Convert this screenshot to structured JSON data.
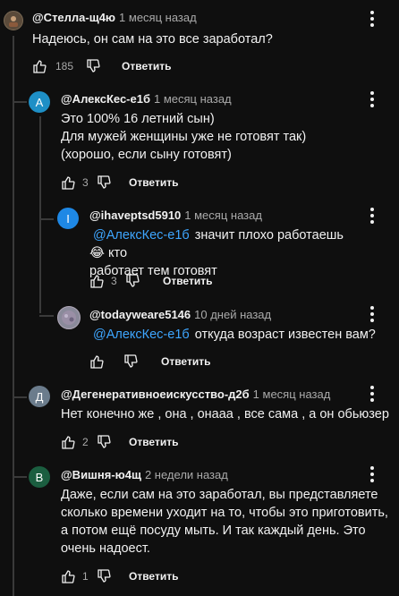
{
  "comments": [
    {
      "author": "@Стелла-щ4ю",
      "time": "1 месяц назад",
      "lines": [
        "Надеюсь, он сам на это все заработал?"
      ],
      "likes": "185",
      "reply_label": "Ответить",
      "avatar_letter": "",
      "avatar_color": "#5a4a3a"
    },
    {
      "author": "@АлексКес-е1б",
      "time": "1 месяц назад",
      "lines": [
        "Это 100% 16 летний сын)",
        "Для мужей женщины уже не готовят так)",
        "(хорошо, если сыну готовят)"
      ],
      "likes": "3",
      "reply_label": "Ответить",
      "avatar_letter": "A",
      "avatar_color": "#1e8fc6"
    },
    {
      "author": "@ihaveptsd5910",
      "time": "1 месяц назад",
      "mention": "@АлексКес-е1б",
      "lines": [
        "значит плохо работаешь 😂 кто",
        "работает тем готовят"
      ],
      "likes": "3",
      "reply_label": "Ответить",
      "avatar_letter": "I",
      "avatar_color": "#1e88e5"
    },
    {
      "author": "@todayweare5146",
      "time": "10 дней назад",
      "mention": "@АлексКес-е1б",
      "lines": [
        "откуда возраст известен вам?"
      ],
      "likes": "",
      "reply_label": "Ответить",
      "avatar_letter": "",
      "avatar_color": "#8a8a9a"
    },
    {
      "author": "@Дегенеративноеискусство-д2б",
      "time": "1 месяц назад",
      "lines": [
        "Нет конечно же , она , онааа , все сама , а он обьюзер"
      ],
      "likes": "2",
      "reply_label": "Ответить",
      "avatar_letter": "Д",
      "avatar_color": "#6b7c8c"
    },
    {
      "author": "@Вишня-ю4щ",
      "time": "2 недели назад",
      "lines": [
        "Даже, если сам на это заработал, вы представляете",
        "сколько времени уходит на то, чтобы это приготовить,",
        "а потом ещё посуду мыть. И так каждый день. Это",
        "очень надоест."
      ],
      "likes": "1",
      "reply_label": "Ответить",
      "avatar_letter": "В",
      "avatar_color": "#1b5e40"
    }
  ]
}
